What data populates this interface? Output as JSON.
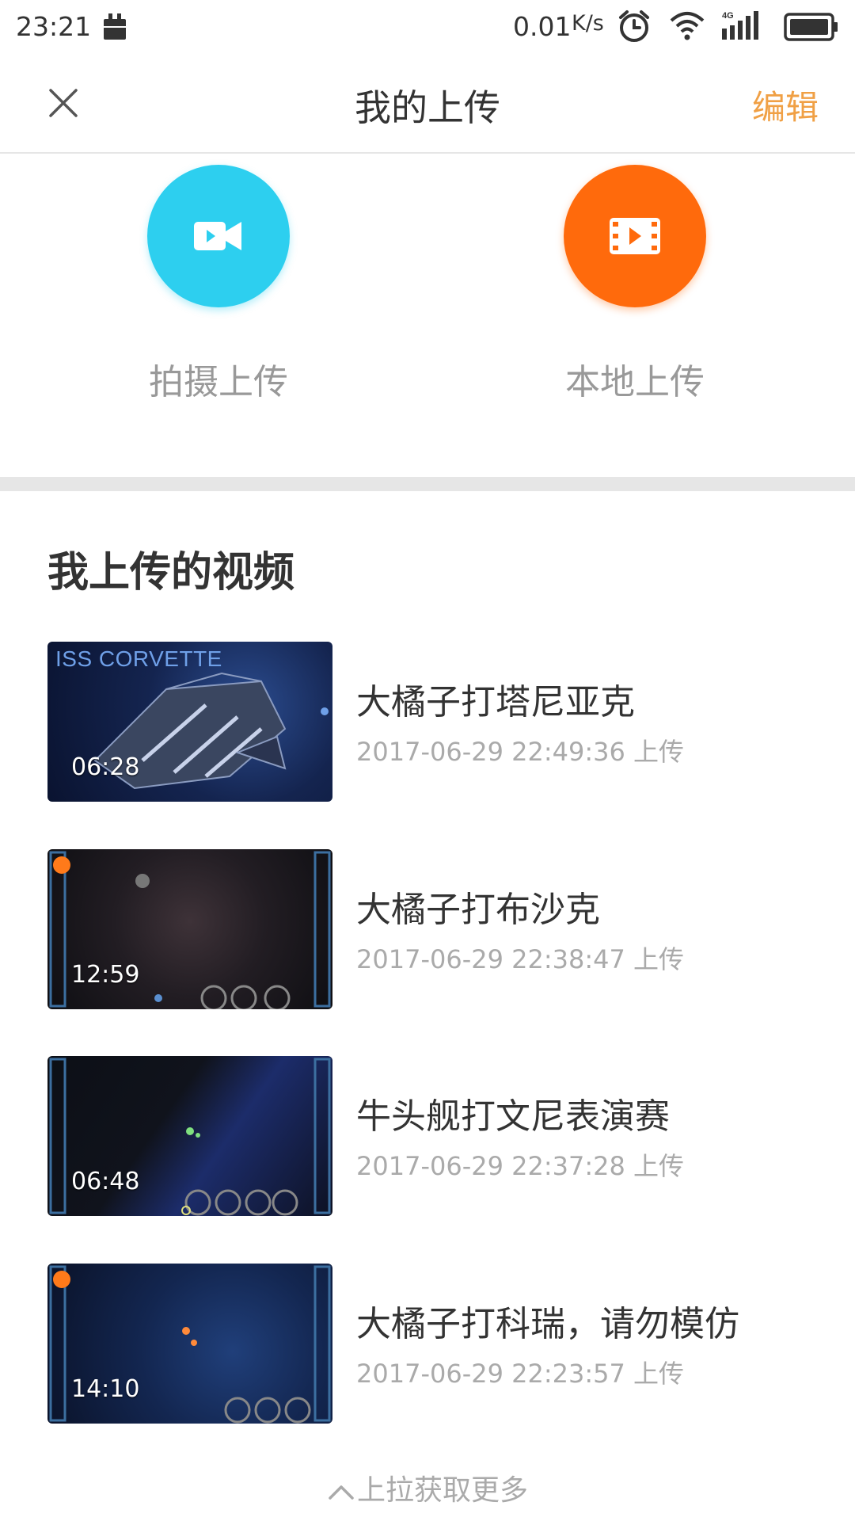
{
  "status_bar": {
    "time": "23:21",
    "net_speed": "0.01",
    "net_speed_unit": "K/s",
    "signal_type": "4G",
    "icons": [
      "notification-icon",
      "alarm-icon",
      "wifi-icon",
      "signal-icon",
      "battery-icon"
    ]
  },
  "header": {
    "title": "我的上传",
    "edit_label": "编辑",
    "close_icon": "close-icon"
  },
  "upload": {
    "shoot_label": "拍摄上传",
    "local_label": "本地上传",
    "shoot_color": "#2dcfef",
    "local_color": "#ff6a0c"
  },
  "section": {
    "title": "我上传的视频"
  },
  "videos": [
    {
      "title": "大橘子打塔尼亚克",
      "time": "2017-06-29 22:49:36 上传",
      "duration": "06:28",
      "thumb_text": "ISS CORVETTE"
    },
    {
      "title": "大橘子打布沙克",
      "time": "2017-06-29 22:38:47 上传",
      "duration": "12:59"
    },
    {
      "title": "牛头舰打文尼表演赛",
      "time": "2017-06-29 22:37:28 上传",
      "duration": "06:48"
    },
    {
      "title": "大橘子打科瑞，请勿模仿",
      "time": "2017-06-29 22:23:57 上传",
      "duration": "14:10"
    }
  ],
  "footer": {
    "load_more": "上拉获取更多"
  },
  "colors": {
    "accent": "#f0a045",
    "divider": "#e6e6e6",
    "muted_text": "#aaaaaa"
  }
}
